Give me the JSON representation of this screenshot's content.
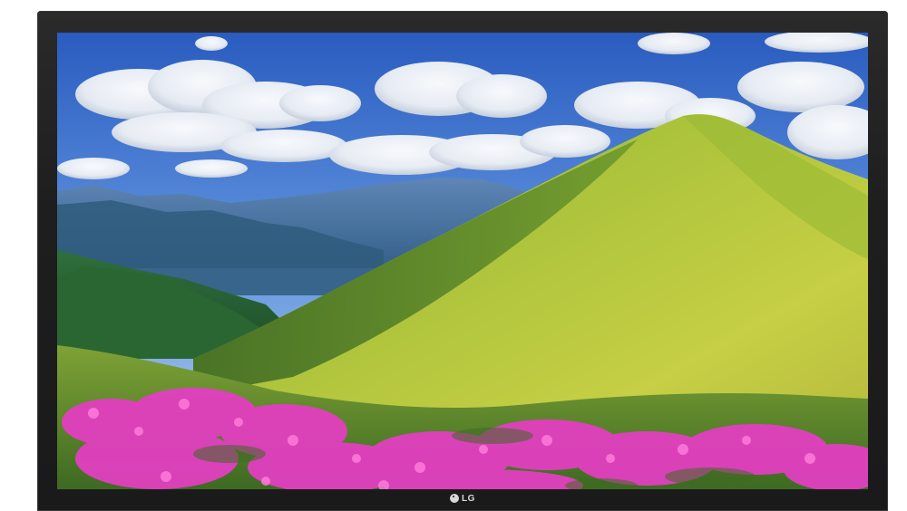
{
  "device": {
    "type": "tv",
    "bezel_color": "#1e1e1f",
    "brand_logo": "LG"
  },
  "screen": {
    "scene": "mountain-meadow-landscape",
    "colors": {
      "sky_top": "#2f61c4",
      "sky_bottom": "#9fc3ea",
      "cloud": "#f4f6f9",
      "far_mountain": "#3f6ea4",
      "forest": "#2c6b3c",
      "hill_light": "#b9c93b",
      "hill_dark": "#5d8a2a",
      "flowers": "#e23fc0"
    }
  }
}
